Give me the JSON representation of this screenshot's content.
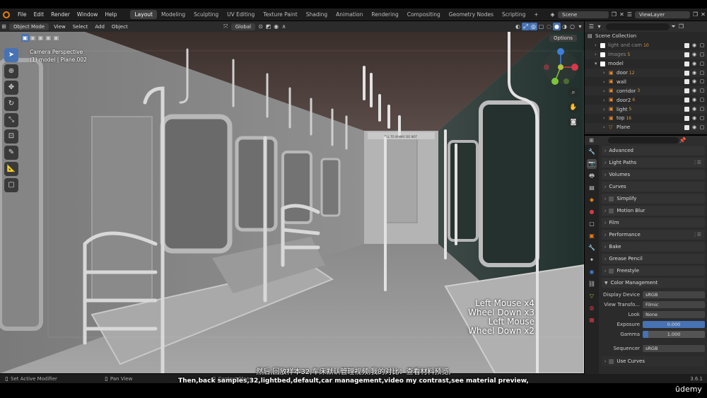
{
  "menubar": {
    "items": [
      "File",
      "Edit",
      "Render",
      "Window",
      "Help"
    ],
    "workspaces": [
      "Layout",
      "Modeling",
      "Sculpting",
      "UV Editing",
      "Texture Paint",
      "Shading",
      "Animation",
      "Rendering",
      "Compositing",
      "Geometry Nodes",
      "Scripting"
    ],
    "active_workspace": "Layout",
    "add_tab": "+",
    "scene_label": "Scene",
    "viewlayer_label": "ViewLayer"
  },
  "viewport_header": {
    "mode": "Object Mode",
    "menus": [
      "View",
      "Select",
      "Add",
      "Object"
    ],
    "transform_orientation": "Global",
    "options_label": "Options"
  },
  "viewport": {
    "camera_label": "Camera Perspective",
    "object_label": "(1) model | Plane.002",
    "keystrokes": [
      "Left Mouse x4",
      "Wheel Down x3",
      "Left Mouse",
      "Wheel Down x2"
    ],
    "sign_text": "ELL TO W·WAY DO NOT"
  },
  "outliner": {
    "root": "Scene Collection",
    "rows": [
      {
        "name": "light and cam",
        "type": "collection",
        "badge": "10",
        "dim": true
      },
      {
        "name": "images",
        "type": "collection",
        "badge": "5",
        "dim": true
      },
      {
        "name": "model",
        "type": "collection",
        "badge": "",
        "dim": false
      },
      {
        "name": "door",
        "type": "object",
        "badge": "12",
        "dim": false
      },
      {
        "name": "wall",
        "type": "object",
        "badge": "",
        "dim": false
      },
      {
        "name": "corridor",
        "type": "object",
        "badge": "3",
        "dim": false
      },
      {
        "name": "door2",
        "type": "object",
        "badge": "6",
        "dim": false
      },
      {
        "name": "light",
        "type": "object",
        "badge": "5",
        "dim": false
      },
      {
        "name": "top",
        "type": "object",
        "badge": "16",
        "dim": false
      },
      {
        "name": "Plane",
        "type": "object",
        "badge": "",
        "dim": false
      }
    ]
  },
  "properties": {
    "panels": [
      {
        "label": "Advanced",
        "checkbox": false,
        "grip": false
      },
      {
        "label": "Light Paths",
        "checkbox": false,
        "grip": true
      },
      {
        "label": "Volumes",
        "checkbox": false,
        "grip": false
      },
      {
        "label": "Curves",
        "checkbox": false,
        "grip": false
      },
      {
        "label": "Simplify",
        "checkbox": true,
        "grip": false
      },
      {
        "label": "Motion Blur",
        "checkbox": true,
        "grip": false
      },
      {
        "label": "Film",
        "checkbox": false,
        "grip": false
      },
      {
        "label": "Performance",
        "checkbox": false,
        "grip": true
      },
      {
        "label": "Bake",
        "checkbox": false,
        "grip": false
      },
      {
        "label": "Grease Pencil",
        "checkbox": false,
        "grip": false
      },
      {
        "label": "Freestyle",
        "checkbox": true,
        "grip": false
      }
    ],
    "color_management": {
      "label": "Color Management",
      "display_device_label": "Display Device",
      "display_device": "sRGB",
      "view_transform_label": "View Transfo...",
      "view_transform": "Filmic",
      "look_label": "Look",
      "look": "None",
      "exposure_label": "Exposure",
      "exposure": "0.000",
      "gamma_label": "Gamma",
      "gamma": "1.000",
      "sequencer_label": "Sequencer",
      "sequencer": "sRGB",
      "use_curves_label": "Use Curves"
    }
  },
  "statusbar": {
    "left": "Set Active Modifier",
    "middle": "Pan View",
    "right_hint": "Context Menu",
    "version": "3.6.1"
  },
  "subtitles": {
    "zh": "然后,回放样本32,车床默认管理视频,我的对比：查看材料预览,",
    "en": "Then,back samples,32,lightbed,default,car management,video my contrast,see material preview,"
  },
  "watermark": "ūdemy",
  "colors": {
    "accent": "#4772b3",
    "orange": "#e87d0d",
    "x_axis": "#d6394b",
    "y_axis": "#7ec53c",
    "z_axis": "#3d7fd9"
  }
}
